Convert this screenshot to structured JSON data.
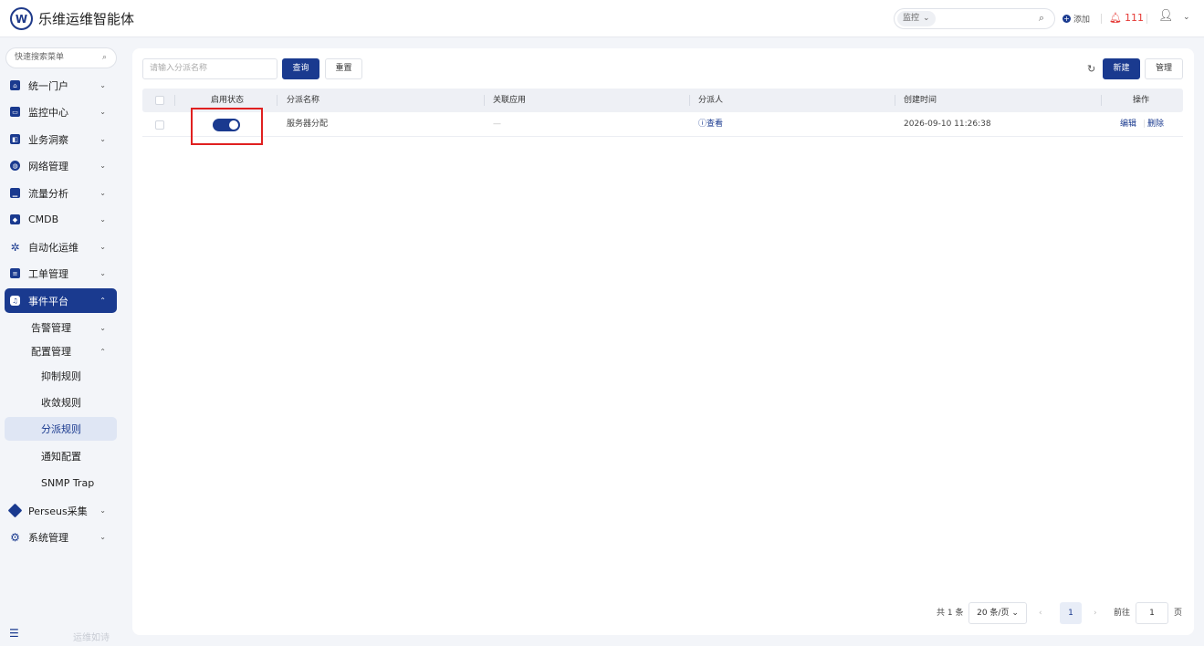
{
  "app": {
    "title": "乐维运维智能体",
    "logo_letter": "W"
  },
  "topbar": {
    "search_scope": "监控",
    "add_label": "添加",
    "alert_count": "111"
  },
  "sidebar": {
    "search_placeholder": "快速搜索菜单",
    "menu": [
      {
        "label": "统一门户"
      },
      {
        "label": "监控中心"
      },
      {
        "label": "业务洞察"
      },
      {
        "label": "网络管理"
      },
      {
        "label": "流量分析"
      },
      {
        "label": "CMDB"
      },
      {
        "label": "自动化运维"
      },
      {
        "label": "工单管理"
      },
      {
        "label": "事件平台"
      },
      {
        "label": "Perseus采集"
      },
      {
        "label": "系统管理"
      }
    ],
    "sub": {
      "alarm": "告警管理",
      "config": "配置管理",
      "items": [
        "抑制规则",
        "收敛规则",
        "分派规则",
        "通知配置",
        "SNMP Trap"
      ]
    },
    "footer_text": "运维如诗"
  },
  "toolbar": {
    "filter_placeholder": "请输入分派名称",
    "query_label": "查询",
    "reset_label": "重置",
    "new_label": "新建",
    "manage_label": "管理"
  },
  "table": {
    "columns": [
      "启用状态",
      "分派名称",
      "关联应用",
      "分派人",
      "创建时间",
      "操作"
    ],
    "rows": [
      {
        "enabled": true,
        "name": "服务器分配",
        "app": "—",
        "assignee_link": "查看",
        "created": "2026-09-10 11:26:38",
        "edit_label": "编辑",
        "delete_label": "删除"
      }
    ]
  },
  "pagination": {
    "total": "共 1 条",
    "page_size": "20 条/页",
    "current_page": "1",
    "goto_label": "前往",
    "goto_value": "1",
    "page_unit": "页"
  },
  "colors": {
    "accent": "#1a3a8f",
    "alert": "#e53935",
    "highlight": "#e02020"
  }
}
